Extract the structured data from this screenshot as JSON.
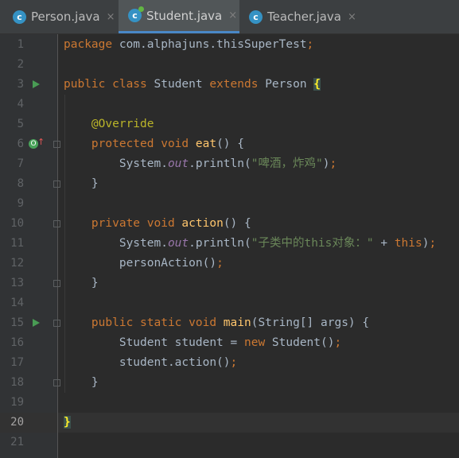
{
  "tabs": [
    {
      "label": "Person.java",
      "icon": "class-icon",
      "active": false
    },
    {
      "label": "Student.java",
      "icon": "class-icon",
      "active": true
    },
    {
      "label": "Teacher.java",
      "icon": "class-icon",
      "active": false
    }
  ],
  "tab_close_glyph": "×",
  "current_line": 20,
  "lines": [
    {
      "n": "1",
      "tokens": [
        [
          "kw",
          "package "
        ],
        [
          "p",
          "com.alphajuns.thisSuperTest"
        ],
        [
          "kw",
          ";"
        ]
      ]
    },
    {
      "n": "2",
      "tokens": []
    },
    {
      "n": "3",
      "tokens": [
        [
          "kw",
          "public class "
        ],
        [
          "p",
          "Student "
        ],
        [
          "kw",
          "extends "
        ],
        [
          "p",
          "Person "
        ],
        [
          "bh",
          "{"
        ]
      ]
    },
    {
      "n": "4",
      "tokens": []
    },
    {
      "n": "5",
      "tokens": [
        [
          "p",
          "    "
        ],
        [
          "ann",
          "@Override"
        ]
      ]
    },
    {
      "n": "6",
      "tokens": [
        [
          "p",
          "    "
        ],
        [
          "kw",
          "protected void "
        ],
        [
          "fn",
          "eat"
        ],
        [
          "p",
          "() {"
        ]
      ]
    },
    {
      "n": "7",
      "tokens": [
        [
          "p",
          "        System."
        ],
        [
          "fld",
          "out"
        ],
        [
          "p",
          ".println("
        ],
        [
          "str",
          "\"啤酒，炸鸡\""
        ],
        [
          "p",
          ")"
        ],
        [
          "kw",
          ";"
        ]
      ]
    },
    {
      "n": "8",
      "tokens": [
        [
          "p",
          "    }"
        ]
      ]
    },
    {
      "n": "9",
      "tokens": []
    },
    {
      "n": "10",
      "tokens": [
        [
          "p",
          "    "
        ],
        [
          "kw",
          "private void "
        ],
        [
          "fn",
          "action"
        ],
        [
          "p",
          "() {"
        ]
      ]
    },
    {
      "n": "11",
      "tokens": [
        [
          "p",
          "        System."
        ],
        [
          "fld",
          "out"
        ],
        [
          "p",
          ".println("
        ],
        [
          "str",
          "\"子类中的this对象：\""
        ],
        [
          "p",
          " + "
        ],
        [
          "kw",
          "this"
        ],
        [
          "p",
          ")"
        ],
        [
          "kw",
          ";"
        ]
      ]
    },
    {
      "n": "12",
      "tokens": [
        [
          "p",
          "        personAction()"
        ],
        [
          "kw",
          ";"
        ]
      ]
    },
    {
      "n": "13",
      "tokens": [
        [
          "p",
          "    }"
        ]
      ]
    },
    {
      "n": "14",
      "tokens": []
    },
    {
      "n": "15",
      "tokens": [
        [
          "p",
          "    "
        ],
        [
          "kw",
          "public static void "
        ],
        [
          "fn",
          "main"
        ],
        [
          "p",
          "(String[] args) {"
        ]
      ]
    },
    {
      "n": "16",
      "tokens": [
        [
          "p",
          "        Student student = "
        ],
        [
          "kw",
          "new "
        ],
        [
          "p",
          "Student()"
        ],
        [
          "kw",
          ";"
        ]
      ]
    },
    {
      "n": "17",
      "tokens": [
        [
          "p",
          "        student.action()"
        ],
        [
          "kw",
          ";"
        ]
      ]
    },
    {
      "n": "18",
      "tokens": [
        [
          "p",
          "    }"
        ]
      ]
    },
    {
      "n": "19",
      "tokens": []
    },
    {
      "n": "20",
      "tokens": [
        [
          "bh",
          "}"
        ]
      ]
    },
    {
      "n": "21",
      "tokens": []
    }
  ],
  "gutter_icons": [
    {
      "line": 3,
      "type": "run-icon"
    },
    {
      "line": 6,
      "type": "override-icon",
      "glyph": "O"
    },
    {
      "line": 15,
      "type": "run-icon"
    }
  ],
  "colors": {
    "keyword": "#cc7832",
    "string": "#6a8759",
    "function": "#ffc66d",
    "annotation": "#bbb529",
    "field": "#9876aa",
    "accent": "#4a88c7"
  }
}
